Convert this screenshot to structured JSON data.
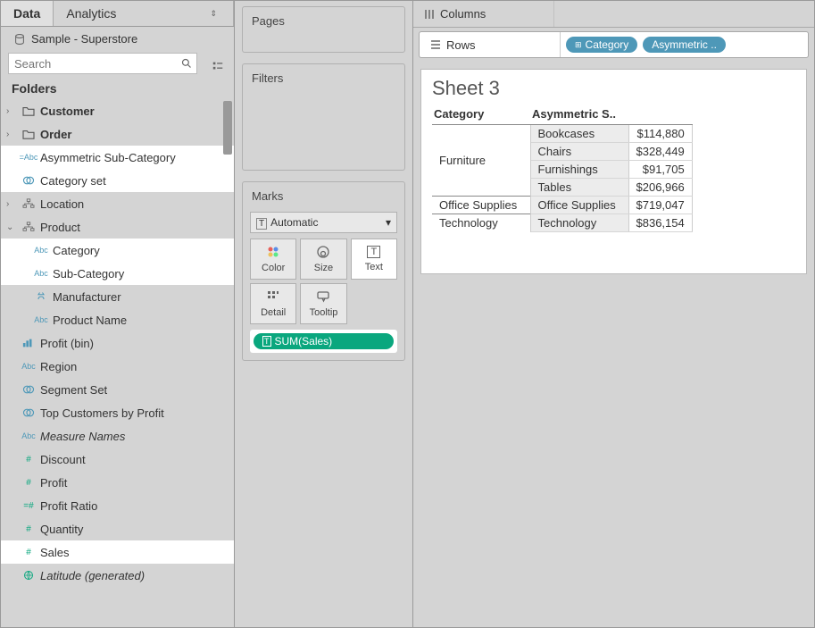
{
  "left": {
    "tab_data": "Data",
    "tab_analytics": "Analytics",
    "datasource": "Sample - Superstore",
    "search_placeholder": "Search",
    "folders_label": "Folders",
    "tree": {
      "customer": "Customer",
      "order": "Order",
      "asym_subcat": "Asymmetric Sub-Category",
      "category_set": "Category set",
      "location": "Location",
      "product": "Product",
      "category": "Category",
      "sub_category": "Sub-Category",
      "manufacturer": "Manufacturer",
      "product_name": "Product Name",
      "profit_bin": "Profit (bin)",
      "region": "Region",
      "segment_set": "Segment Set",
      "top_customers": "Top Customers by Profit",
      "measure_names": "Measure Names",
      "discount": "Discount",
      "profit": "Profit",
      "profit_ratio": "Profit Ratio",
      "quantity": "Quantity",
      "sales": "Sales",
      "latitude": "Latitude (generated)"
    }
  },
  "mid": {
    "pages": "Pages",
    "filters": "Filters",
    "marks": "Marks",
    "mark_type": "Automatic",
    "mark_color": "Color",
    "mark_size": "Size",
    "mark_text": "Text",
    "mark_detail": "Detail",
    "mark_tooltip": "Tooltip",
    "pill_sum_sales": "SUM(Sales)"
  },
  "right": {
    "columns": "Columns",
    "rows": "Rows",
    "pill_category": "Category",
    "pill_asym": "Asymmetric ..",
    "sheet_title": "Sheet 3",
    "header_category": "Category",
    "header_sub": "Asymmetric S..",
    "rows_data": {
      "furniture": "Furniture",
      "furn_sub": [
        "Bookcases",
        "Chairs",
        "Furnishings",
        "Tables"
      ],
      "furn_val": [
        "$114,880",
        "$328,449",
        "$91,705",
        "$206,966"
      ],
      "office": "Office Supplies",
      "office_sub": "Office Supplies",
      "office_val": "$719,047",
      "tech": "Technology",
      "tech_sub": "Technology",
      "tech_val": "$836,154"
    }
  }
}
